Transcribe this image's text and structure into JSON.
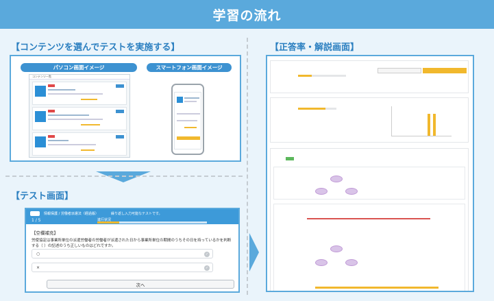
{
  "banner": {
    "title": "学習の流れ"
  },
  "sections": {
    "contents": "【コンテンツを選んでテストを実施する】",
    "result": "【正答率・解説画面】",
    "test": "【テスト画面】"
  },
  "contents": {
    "pc_label": "パソコン画面イメージ",
    "sp_label": "スマートフォン画面イメージ",
    "list_header": "コンテンツ一覧"
  },
  "test": {
    "header_title": "情報保護 / 労働者派遣法（経過版）",
    "header_note": "繰り返し入力可能なテストです。",
    "counter": "1 / 5",
    "progress_label": "進行状況",
    "progress_fraction": 0.2,
    "question_label": "【空欄補充】",
    "question_text": "労使協定は事業所単位の派遣労働者の労働者が派遣された日から事業所単位の期間のうちその日を持っているかを判断する（  ）の記述のうち正しいものはどれですか。",
    "options": [
      "○",
      "×"
    ],
    "next_button": "次へ"
  },
  "colors": {
    "accent": "#5aa9dc",
    "button": "#3d92d1",
    "warn": "#f1b82d"
  }
}
